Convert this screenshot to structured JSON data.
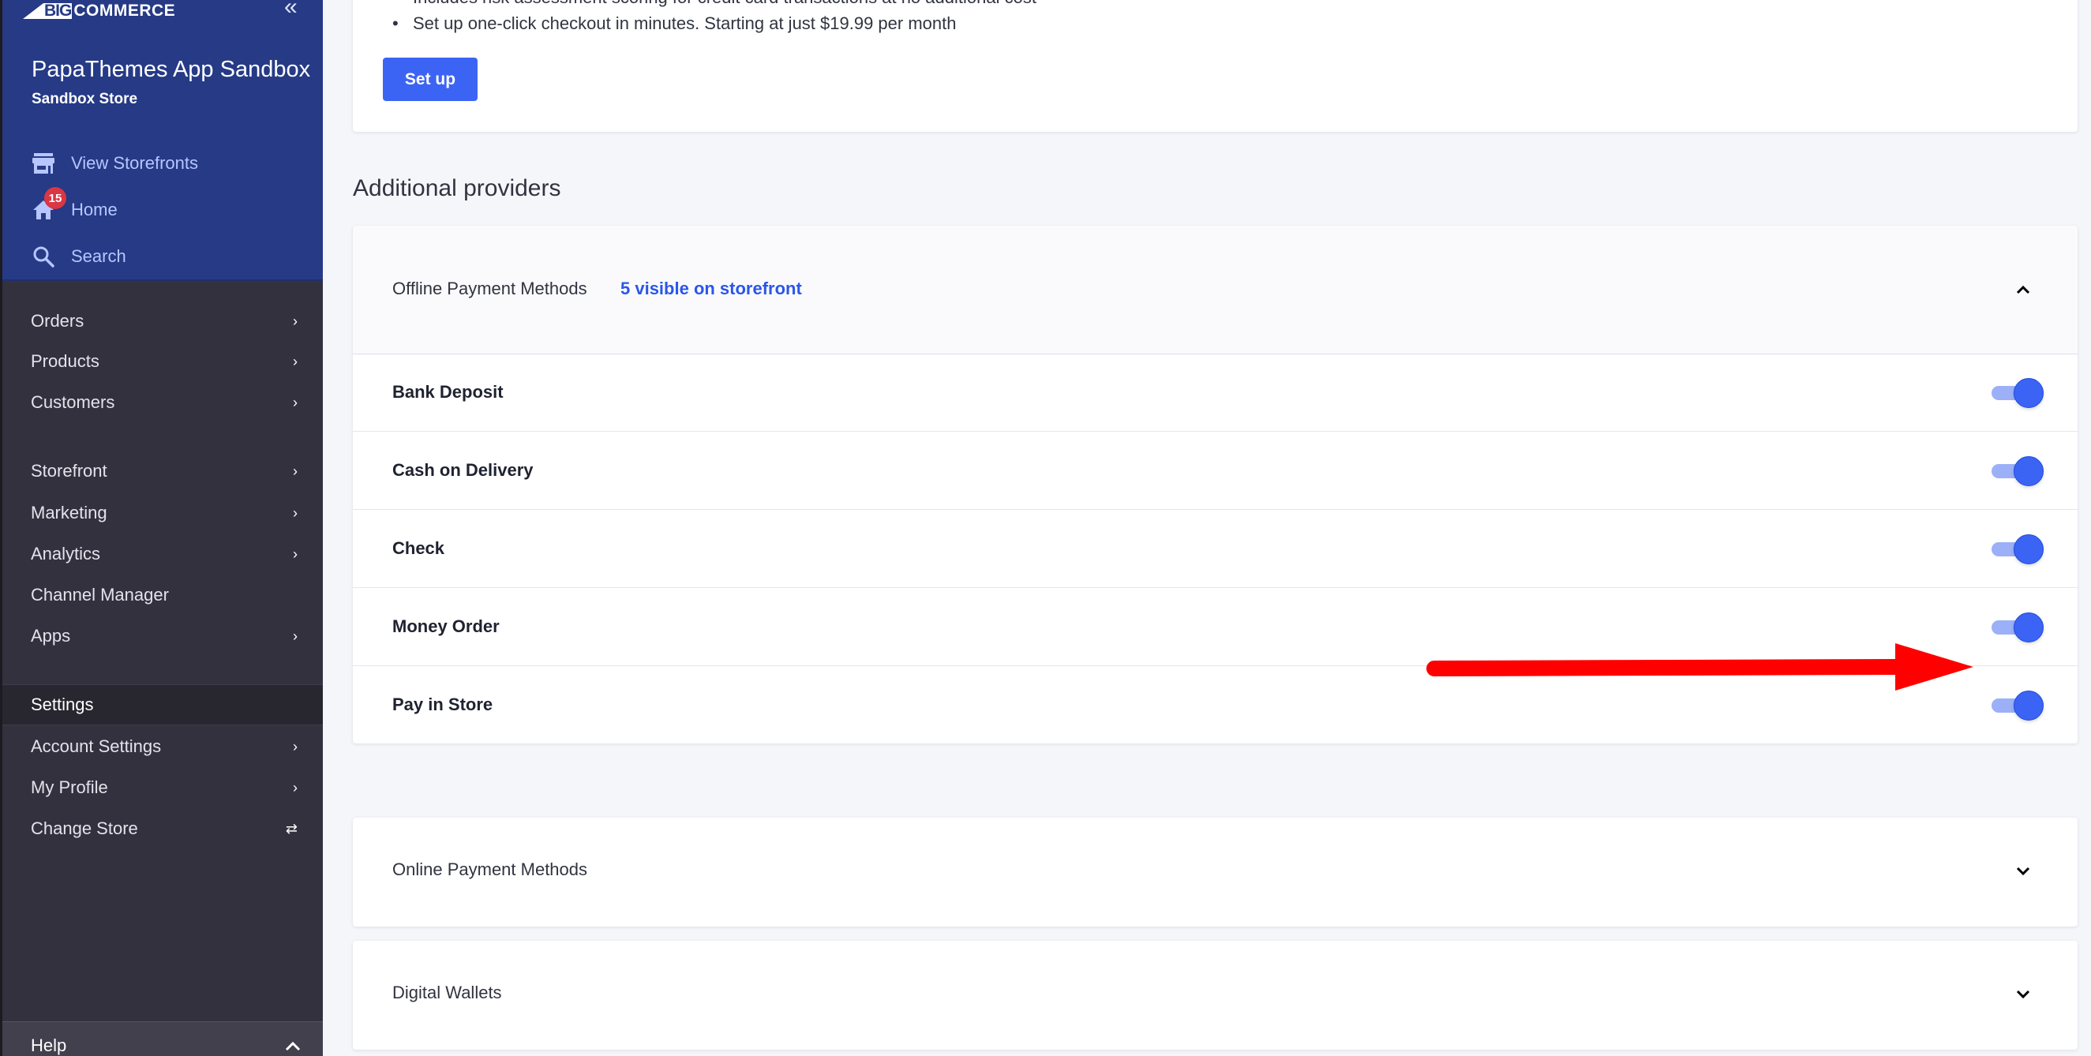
{
  "sidebar": {
    "logo": {
      "big": "BIG",
      "rest": "COMMERCE"
    },
    "collapse_icon": "«",
    "store_name": "PapaThemes App Sandbox",
    "store_type": "Sandbox Store",
    "quick_links": [
      {
        "label": "View Storefronts",
        "icon": "storefront-icon"
      },
      {
        "label": "Home",
        "icon": "home-icon",
        "badge": "15"
      },
      {
        "label": "Search",
        "icon": "search-icon"
      }
    ],
    "nav_groups": [
      [
        {
          "label": "Orders",
          "chevron": "›"
        },
        {
          "label": "Products",
          "chevron": "›"
        },
        {
          "label": "Customers",
          "chevron": "›"
        }
      ],
      [
        {
          "label": "Storefront",
          "chevron": "›"
        },
        {
          "label": "Marketing",
          "chevron": "›"
        },
        {
          "label": "Analytics",
          "chevron": "›"
        },
        {
          "label": "Channel Manager",
          "chevron": ""
        },
        {
          "label": "Apps",
          "chevron": "›"
        }
      ],
      [
        {
          "label": "Settings",
          "chevron": "",
          "active": true
        },
        {
          "label": "Account Settings",
          "chevron": "›"
        },
        {
          "label": "My Profile",
          "chevron": "›"
        },
        {
          "label": "Change Store",
          "chevron": "⇄"
        }
      ]
    ],
    "help": {
      "label": "Help",
      "chevron": "⌃"
    }
  },
  "top_card": {
    "bullets": [
      "Includes risk assessment scoring for credit card transactions at no additional cost",
      "Set up one-click checkout in minutes. Starting at just $19.99 per month"
    ],
    "setup_button": "Set up"
  },
  "additional_providers": {
    "title": "Additional providers",
    "offline": {
      "title": "Offline Payment Methods",
      "count_label": "5 visible on storefront",
      "expanded": true,
      "methods": [
        {
          "label": "Bank Deposit",
          "enabled": true
        },
        {
          "label": "Cash on Delivery",
          "enabled": true
        },
        {
          "label": "Check",
          "enabled": true
        },
        {
          "label": "Money Order",
          "enabled": true
        },
        {
          "label": "Pay in Store",
          "enabled": true
        }
      ]
    },
    "online": {
      "title": "Online Payment Methods",
      "expanded": false
    },
    "wallets": {
      "title": "Digital Wallets",
      "expanded": false
    }
  },
  "annotation": {
    "type": "red-arrow",
    "points_to": "Money Order toggle",
    "color": "#ff0000"
  },
  "colors": {
    "accent": "#3c64f4",
    "sidebar_header": "#263a86",
    "sidebar_nav": "#34313f",
    "badge": "#db3643",
    "link": "#2b56e8"
  }
}
